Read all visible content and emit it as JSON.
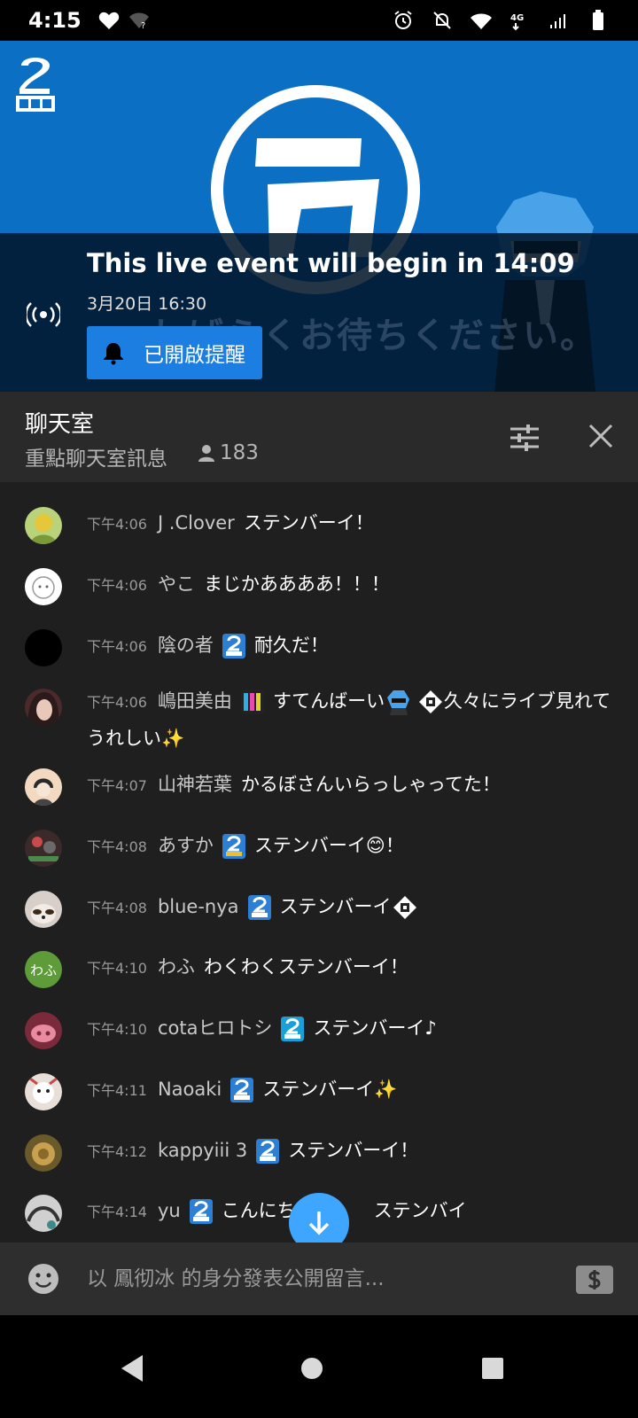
{
  "status_bar": {
    "time": "4:15",
    "icons_left": [
      "heart-icon",
      "wifi-unknown-icon"
    ],
    "icons_right": [
      "alarm-icon",
      "notifications-off-icon",
      "wifi-icon",
      "signal-4g-icon",
      "signal-bars-icon",
      "battery-icon"
    ]
  },
  "video": {
    "overlay_bg_text": "しばらくお待ちください。",
    "live_title": "This live event will begin in 14:09",
    "live_date": "3月20日 16:30",
    "remind_label": "已開啟提醒"
  },
  "chat_header": {
    "title": "聊天室",
    "subtitle": "重點聊天室訊息",
    "viewers": "183"
  },
  "messages": [
    {
      "time": "下午4:06",
      "author": "J .Clover",
      "text": "ステンバーイ！"
    },
    {
      "time": "下午4:06",
      "author": "やこ",
      "text": "まじかああああ！！！"
    },
    {
      "time": "下午4:06",
      "author": "陰の者",
      "text": "耐久だ！"
    },
    {
      "time": "下午4:06",
      "author": "嶋田美由",
      "text": "すてんばーい",
      "text2": "久々にライブ見れてうれしい✨"
    },
    {
      "time": "下午4:07",
      "author": "山神若葉",
      "text": "かるぼさんいらっしゃってた！"
    },
    {
      "time": "下午4:08",
      "author": "あすか",
      "text": "ステンバーイ😊！"
    },
    {
      "time": "下午4:08",
      "author": "blue-nya",
      "text": "ステンバーイ"
    },
    {
      "time": "下午4:10",
      "author": "わふ",
      "text": "わくわくステンバーイ！",
      "avatar_text": "わふ"
    },
    {
      "time": "下午4:10",
      "author": "cotaヒロトシ",
      "text": "ステンバーイ♪"
    },
    {
      "time": "下午4:11",
      "author": "Naoaki",
      "text": "ステンバーイ✨"
    },
    {
      "time": "下午4:12",
      "author": "kappyiii 3",
      "text": "ステンバーイ！"
    },
    {
      "time": "下午4:14",
      "author": "yu",
      "text": "こんにち",
      "text_after": "ステンバイ"
    }
  ],
  "input": {
    "placeholder": "以 鳳彻冰 的身分發表公開留言..."
  },
  "colors": {
    "accent_blue": "#3ea6ff",
    "video_blue": "#0b70c4",
    "remind_blue": "#1c7ee0",
    "chat_bg": "#1f1f1f",
    "header_bg": "#2a2a2a"
  }
}
